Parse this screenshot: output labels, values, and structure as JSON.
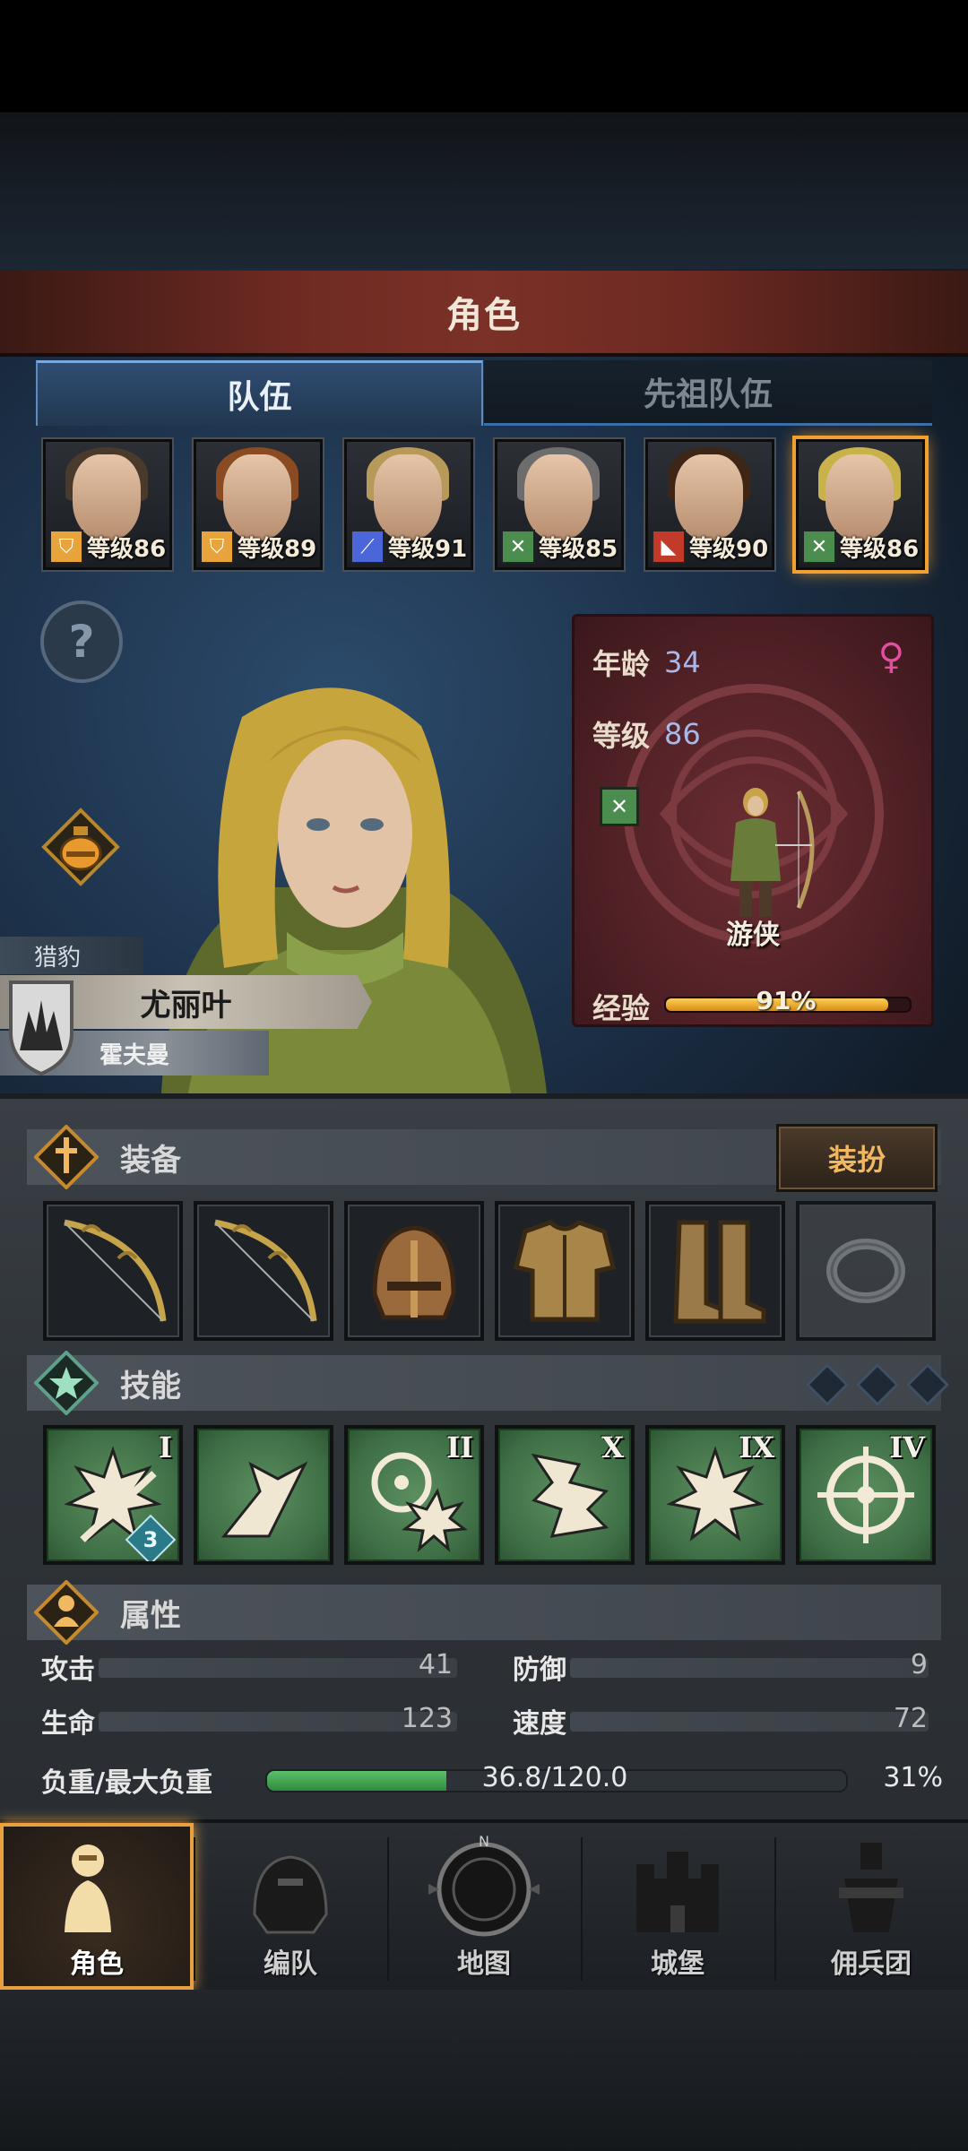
{
  "title": "角色",
  "tabs": [
    {
      "label": "队伍",
      "active": true
    },
    {
      "label": "先祖队伍",
      "active": false
    }
  ],
  "party": [
    {
      "level_text": "等级86",
      "class_icon": "shield-icon",
      "class_color": "#e8a33a",
      "hair": "#4a3a2c",
      "selected": false
    },
    {
      "level_text": "等级89",
      "class_icon": "shield-icon",
      "class_color": "#e8a33a",
      "hair": "#8a4a22",
      "selected": false
    },
    {
      "level_text": "等级91",
      "class_icon": "sword-icon",
      "class_color": "#4a66d8",
      "hair": "#b79a5a",
      "selected": false
    },
    {
      "level_text": "等级85",
      "class_icon": "crossed-arrows-icon",
      "class_color": "#4b8d4f",
      "hair": "#6d6d6d",
      "selected": false
    },
    {
      "level_text": "等级90",
      "class_icon": "wolf-icon",
      "class_color": "#c23a2a",
      "hair": "#3d2616",
      "selected": false
    },
    {
      "level_text": "等级86",
      "class_icon": "crossed-arrows-icon",
      "class_color": "#4b8d4f",
      "hair": "#c9b24a",
      "selected": true
    }
  ],
  "character": {
    "trait": "猎豹",
    "name": "尤丽叶",
    "clan": "霍夫曼",
    "age_label": "年龄",
    "age": "34",
    "level_label": "等级",
    "level": "86",
    "class_name": "游侠",
    "exp_label": "经验",
    "exp_percent_text": "91%",
    "exp_fraction": 0.91,
    "gender_icon": "female-icon"
  },
  "equipment": {
    "section_title": "装备",
    "dress_button": "装扮",
    "slots": [
      "bow-icon",
      "bow-icon",
      "helmet-icon",
      "chest-armor-icon",
      "boots-icon",
      "ring-icon"
    ]
  },
  "skills": {
    "section_title": "技能",
    "items": [
      {
        "icon": "burst-sword-skill-icon",
        "rank": "I",
        "badge": "3"
      },
      {
        "icon": "leap-skill-icon",
        "rank": "",
        "badge": ""
      },
      {
        "icon": "target-burst-skill-icon",
        "rank": "II",
        "badge": ""
      },
      {
        "icon": "claw-skill-icon",
        "rank": "X",
        "badge": ""
      },
      {
        "icon": "burst-skill-icon",
        "rank": "IX",
        "badge": ""
      },
      {
        "icon": "crosshair-skill-icon",
        "rank": "IV",
        "badge": ""
      }
    ]
  },
  "attributes": {
    "section_title": "属性",
    "attack_label": "攻击",
    "attack": "41",
    "defense_label": "防御",
    "defense": "9",
    "hp_label": "生命",
    "hp": "123",
    "speed_label": "速度",
    "speed": "72",
    "load_label": "负重/最大负重",
    "load_text": "36.8/120.0",
    "load_percent_text": "31%",
    "load_fraction": 0.31
  },
  "nav": [
    {
      "label": "角色",
      "icon": "knight-icon",
      "active": true
    },
    {
      "label": "编队",
      "icon": "helmet-formation-icon",
      "active": false
    },
    {
      "label": "地图",
      "icon": "compass-map-icon",
      "active": false
    },
    {
      "label": "城堡",
      "icon": "castle-icon",
      "active": false
    },
    {
      "label": "佣兵团",
      "icon": "mercenary-icon",
      "active": false
    }
  ],
  "colors": {
    "accent_orange": "#f0a030",
    "tab_blue": "#2f4d73",
    "panel_red": "#6b2d33",
    "skill_green": "#4f8455"
  }
}
